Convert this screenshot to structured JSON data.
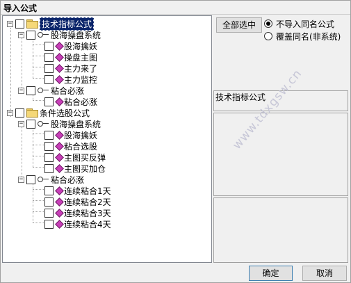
{
  "window": {
    "title": "导入公式"
  },
  "tree": {
    "root1": {
      "label": "技术指标公式"
    },
    "group1": {
      "label": "股海操盘系统"
    },
    "group1_items": [
      "股海擒妖",
      "操盘主图",
      "主力来了",
      "主力监控"
    ],
    "group2": {
      "label": "粘合必涨"
    },
    "group2_items": [
      "粘合必涨"
    ],
    "root2": {
      "label": "条件选股公式"
    },
    "group3": {
      "label": "股海操盘系统"
    },
    "group3_items": [
      "股海擒妖",
      "粘合选股",
      "主图买反弹",
      "主图买加仓"
    ],
    "group4": {
      "label": "粘合必涨"
    },
    "group4_items": [
      "连续粘合1天",
      "连续粘合2天",
      "连续粘合3天",
      "连续粘合4天"
    ],
    "toggle_symbol": "−"
  },
  "controls": {
    "select_all": "全部选中",
    "radio_skip": "不导入同名公式",
    "radio_overwrite": "覆盖同名(非系统)",
    "formula_title": "技术指标公式"
  },
  "footer": {
    "ok": "确定",
    "cancel": "取消"
  },
  "watermark": "www.tdxgsw.cn"
}
